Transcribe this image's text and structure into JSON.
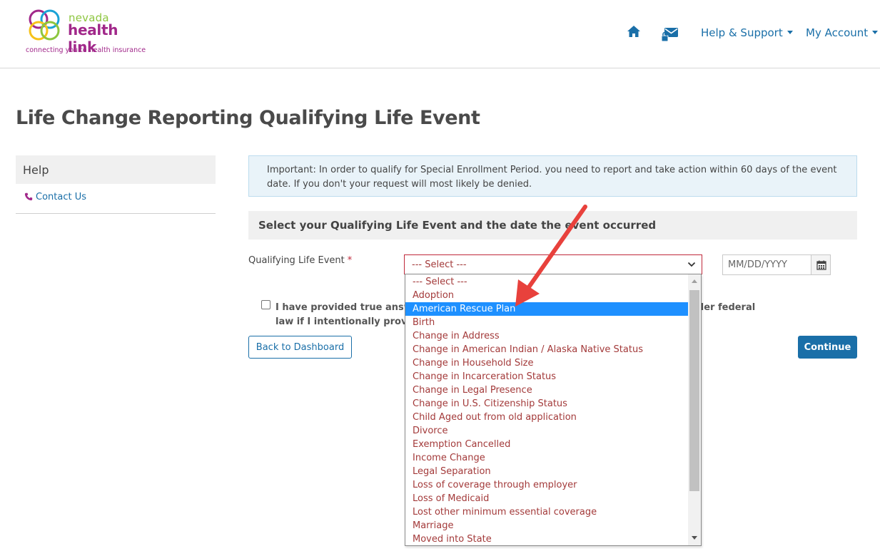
{
  "header": {
    "logo": {
      "line1": "nevada",
      "line2": "health link",
      "tagline": "connecting you to health insurance"
    },
    "nav": {
      "home_icon": "home-icon",
      "messages_icon": "envelope-lock-icon",
      "help_label": "Help & Support",
      "account_label": "My Account"
    }
  },
  "page": {
    "title": "Life Change Reporting Qualifying Life Event"
  },
  "sidebar": {
    "help_title": "Help",
    "contact_label": "Contact Us",
    "contact_icon": "phone-icon"
  },
  "notice": {
    "text": "Important: In order to qualify for Special Enrollment Period. you need to report and take action within 60 days of the event date. If you don't your request will most likely be denied."
  },
  "form": {
    "section_title": "Select your Qualifying Life Event and the date the event occurred",
    "qle_label": "Qualifying Life Event",
    "required_mark": "*",
    "select_value": "--- Select ---",
    "date_placeholder": "MM/DD/YYYY",
    "calendar_icon": "calendar-icon",
    "attestation_visible_start": "I have provided true answers",
    "attestation_visible_end": "be subject to penalties under federal",
    "attestation_line2": "law if I intentionally provide f",
    "back_label": "Back to Dashboard",
    "continue_label": "Continue"
  },
  "dropdown": {
    "selected_index": 2,
    "options": [
      "--- Select ---",
      "Adoption",
      "American Rescue Plan",
      "Birth",
      "Change in Address",
      "Change in American Indian / Alaska Native Status",
      "Change in Household Size",
      "Change in Incarceration Status",
      "Change in Legal Presence",
      "Change in U.S. Citizenship Status",
      "Child Aged out from old application",
      "Divorce",
      "Exemption Cancelled",
      "Income Change",
      "Legal Separation",
      "Loss of coverage through employer",
      "Loss of Medicaid",
      "Lost other minimum essential coverage",
      "Marriage",
      "Moved into State"
    ]
  },
  "colors": {
    "brand_blue": "#1a6fa8",
    "brand_magenta": "#a1288a",
    "brand_green": "#8dc63f",
    "error_red": "#c0283a",
    "option_text": "#a33a3a",
    "highlight": "#1e90ff",
    "annotation_arrow": "#e8413c"
  }
}
